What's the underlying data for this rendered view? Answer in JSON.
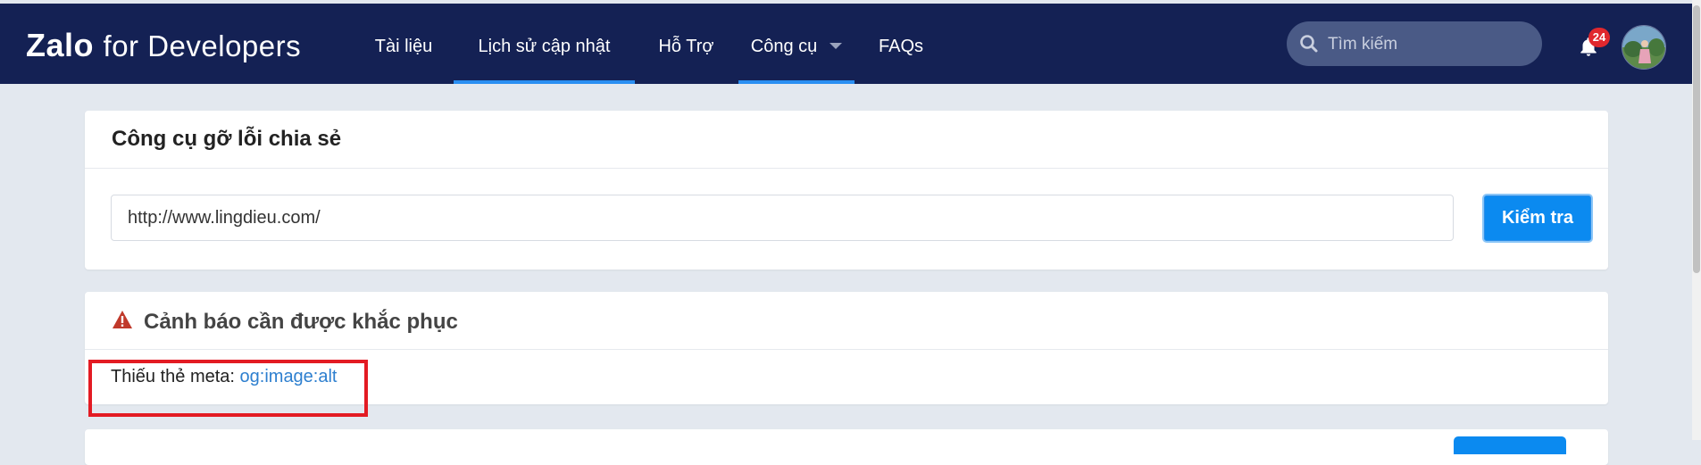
{
  "header": {
    "logo_brand": "Zalo",
    "logo_suffix": "for Developers",
    "nav": [
      {
        "label": "Tài liệu",
        "active": false
      },
      {
        "label": "Lịch sử cập nhật",
        "active": true
      },
      {
        "label": "Hỗ Trợ",
        "active": false
      },
      {
        "label": "Công cụ",
        "active": true,
        "dropdown": true
      },
      {
        "label": "FAQs",
        "active": false
      }
    ],
    "search_placeholder": "Tìm kiếm",
    "notification_count": "24",
    "icons": {
      "search": "search-icon",
      "bell": "bell-icon",
      "caret": "chevron-down-icon",
      "avatar": "user-avatar"
    }
  },
  "debugger": {
    "title": "Công cụ gỡ lỗi chia sẻ",
    "url_value": "http://www.lingdieu.com/",
    "check_button": "Kiểm tra"
  },
  "warnings": {
    "icon": "warning-triangle-icon",
    "title": "Cảnh báo cần được khắc phục",
    "missing_label": "Thiếu thẻ meta:",
    "missing_tag": "og:image:alt"
  },
  "colors": {
    "header_bg": "#142154",
    "accent": "#2a8ff2",
    "button": "#0b8af0",
    "page_bg": "#e3e8ef",
    "warning": "#c0392b",
    "highlight": "#e31b23",
    "link": "#2d7fcf"
  }
}
